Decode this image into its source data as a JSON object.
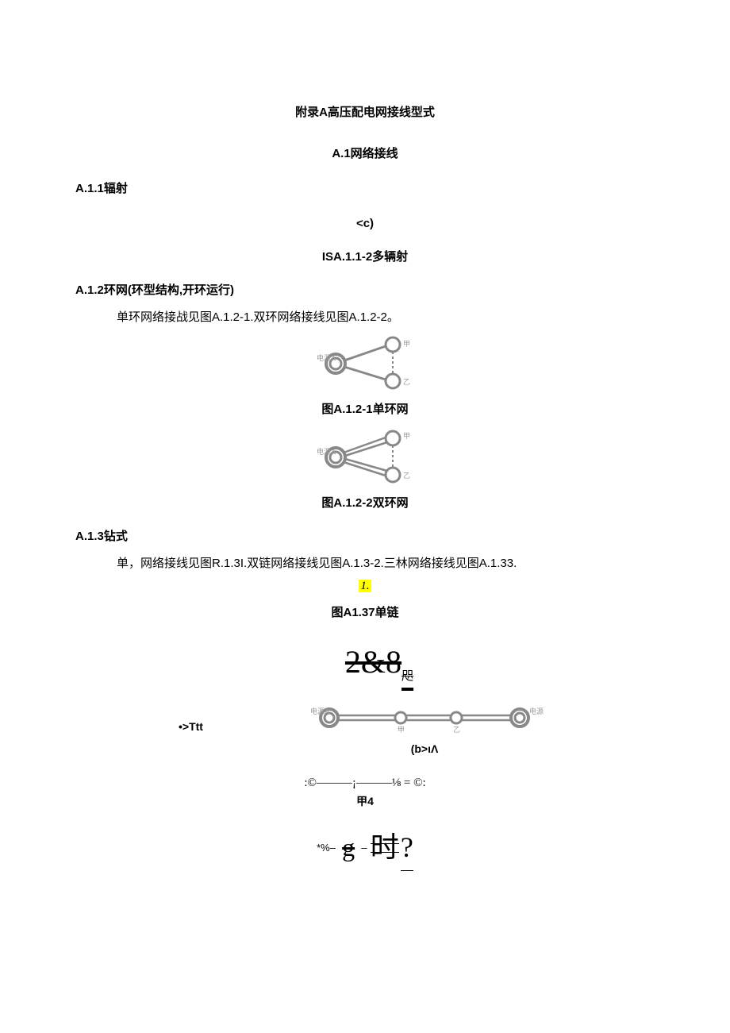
{
  "title": "附录A高压配电网接线型式",
  "section_a1": "A.1网络接线",
  "a11_head": "A.1.1辐射",
  "a11_c": "<c)",
  "a11_label": "ISA.1.1-2多辆射",
  "a12_head": "A.1.2环网(环型结构,开环运行)",
  "a12_body": "单环网络接战见图A.1.2-1.双环网络接线见图A.1.2-2。",
  "fig_a121_labels": {
    "src": "电源A",
    "n1": "甲",
    "n2": "乙"
  },
  "a121_caption": "图A.1.2-1单环网",
  "fig_a122_labels": {
    "src": "电源A",
    "n1": "甲",
    "n2": "乙"
  },
  "a122_caption": "图A.1.2-2双环网",
  "a13_head": "A.1.3钻式",
  "a13_body": "单，网络接线见图R.1.3I.双链网络接线见图A.1.3-2.三林网络接线见图A.1.33.",
  "a13_hl": "1.",
  "a137_caption": "图A1.37单链",
  "big_strike": "2&8",
  "big_strike_suffix": "咫",
  "ttt": "•>Ttt",
  "fig_double_labels": {
    "srcA": "电源A",
    "mid1": "甲",
    "mid2": "乙",
    "srcB": "电源B"
  },
  "sub_b": "(b>ιΛ",
  "formula": ":©———¡———⅛ = ©:",
  "formula_caption": "甲4",
  "fancy": {
    "pre": "*%–",
    "g": "g",
    "dash": "–",
    "cjk": "时",
    "q": "?"
  }
}
